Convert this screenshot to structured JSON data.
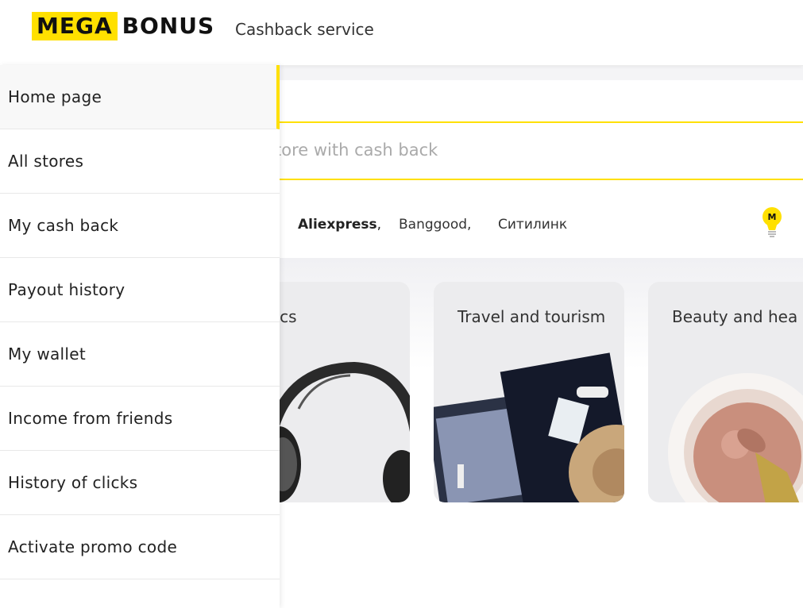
{
  "header": {
    "logo_mega": "MEGA",
    "logo_bonus": "BONUS",
    "tagline": "Cashback service"
  },
  "sidebar": {
    "items": [
      {
        "label": "Home page",
        "active": true
      },
      {
        "label": "All stores"
      },
      {
        "label": "My cash back"
      },
      {
        "label": "Payout history"
      },
      {
        "label": "My wallet"
      },
      {
        "label": "Income from friends"
      },
      {
        "label": "History of clicks"
      },
      {
        "label": "Activate promo code"
      }
    ]
  },
  "search": {
    "placeholder": "tore with cash back"
  },
  "popular_stores": [
    {
      "label": "Aliexpress",
      "bold": true,
      "sep": ","
    },
    {
      "label": "Banggood",
      "sep": ","
    },
    {
      "label": "Ситилинк"
    }
  ],
  "bulb_badge": "M",
  "categories": [
    {
      "title": "tronics"
    },
    {
      "title": "Travel and tourism"
    },
    {
      "title": "Beauty and hea"
    }
  ],
  "colors": {
    "accent": "#ffe000",
    "text": "#222222",
    "placeholder": "#aaaaaa"
  }
}
